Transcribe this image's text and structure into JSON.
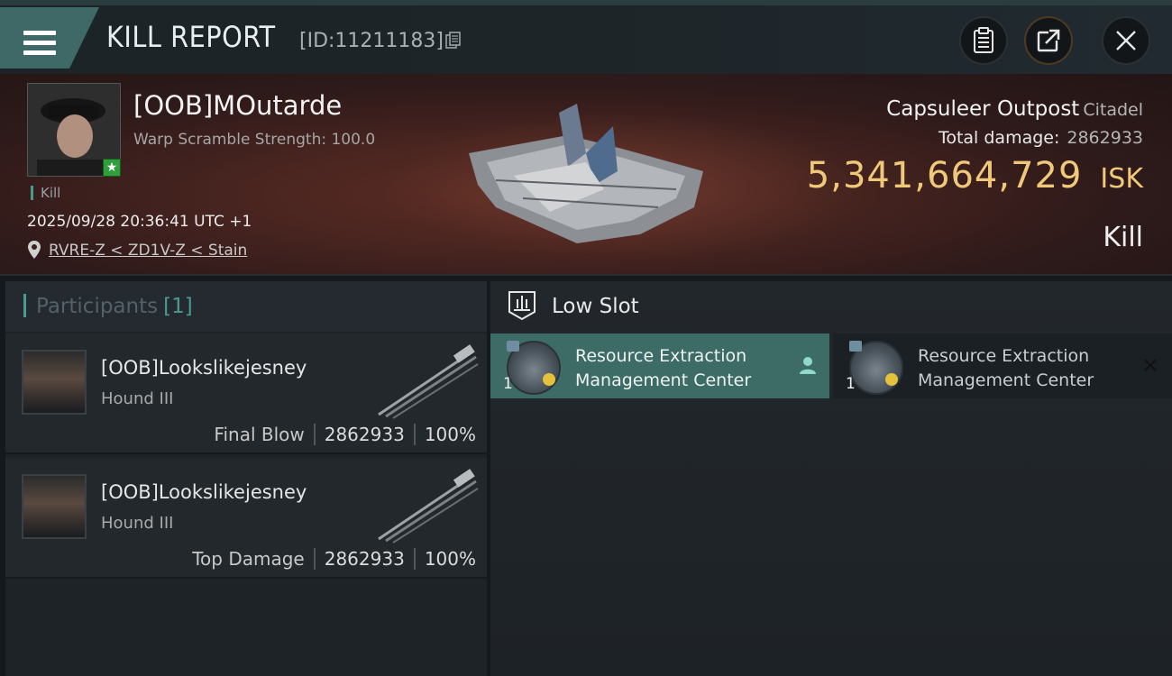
{
  "header": {
    "title": "KILL REPORT",
    "report_id": "[ID:11211183]",
    "icons": [
      "menu-icon",
      "copy-icon",
      "clipboard-icon",
      "share-icon",
      "close-icon"
    ]
  },
  "victim": {
    "name": "[OOB]MOutarde",
    "detail": "Warp Scramble Strength: 100.0",
    "tag": "Kill",
    "timestamp": "2025/09/28 20:36:41 UTC +1",
    "location": "RVRE-Z < ZD1V-Z < Stain",
    "ship_type": "Capsuleer Outpost",
    "ship_class": "Citadel",
    "total_damage_label": "Total damage:",
    "total_damage": "2862933",
    "isk_value": "5,341,664,729",
    "isk_unit": "ISK",
    "result": "Kill"
  },
  "participants": {
    "title": "Participants",
    "count": "[1]",
    "rows": [
      {
        "name": "[OOB]Lookslikejesney",
        "ship": "Hound III",
        "label": "Final Blow",
        "damage": "2862933",
        "percent": "100%"
      },
      {
        "name": "[OOB]Lookslikejesney",
        "ship": "Hound III",
        "label": "Top Damage",
        "damage": "2862933",
        "percent": "100%"
      }
    ]
  },
  "low_slot": {
    "title": "Low Slot",
    "modules": [
      {
        "name_line1": "Resource Extraction",
        "name_line2": "Management Center",
        "qty": "1",
        "state": "active"
      },
      {
        "name_line1": "Resource Extraction",
        "name_line2": "Management Center",
        "qty": "1",
        "state": "inactive"
      }
    ]
  },
  "colors": {
    "accent": "#4a9b8f",
    "active_slot": "#3d6b65",
    "isk": "#f0c87a",
    "badge_green": "#2f9e3b"
  }
}
